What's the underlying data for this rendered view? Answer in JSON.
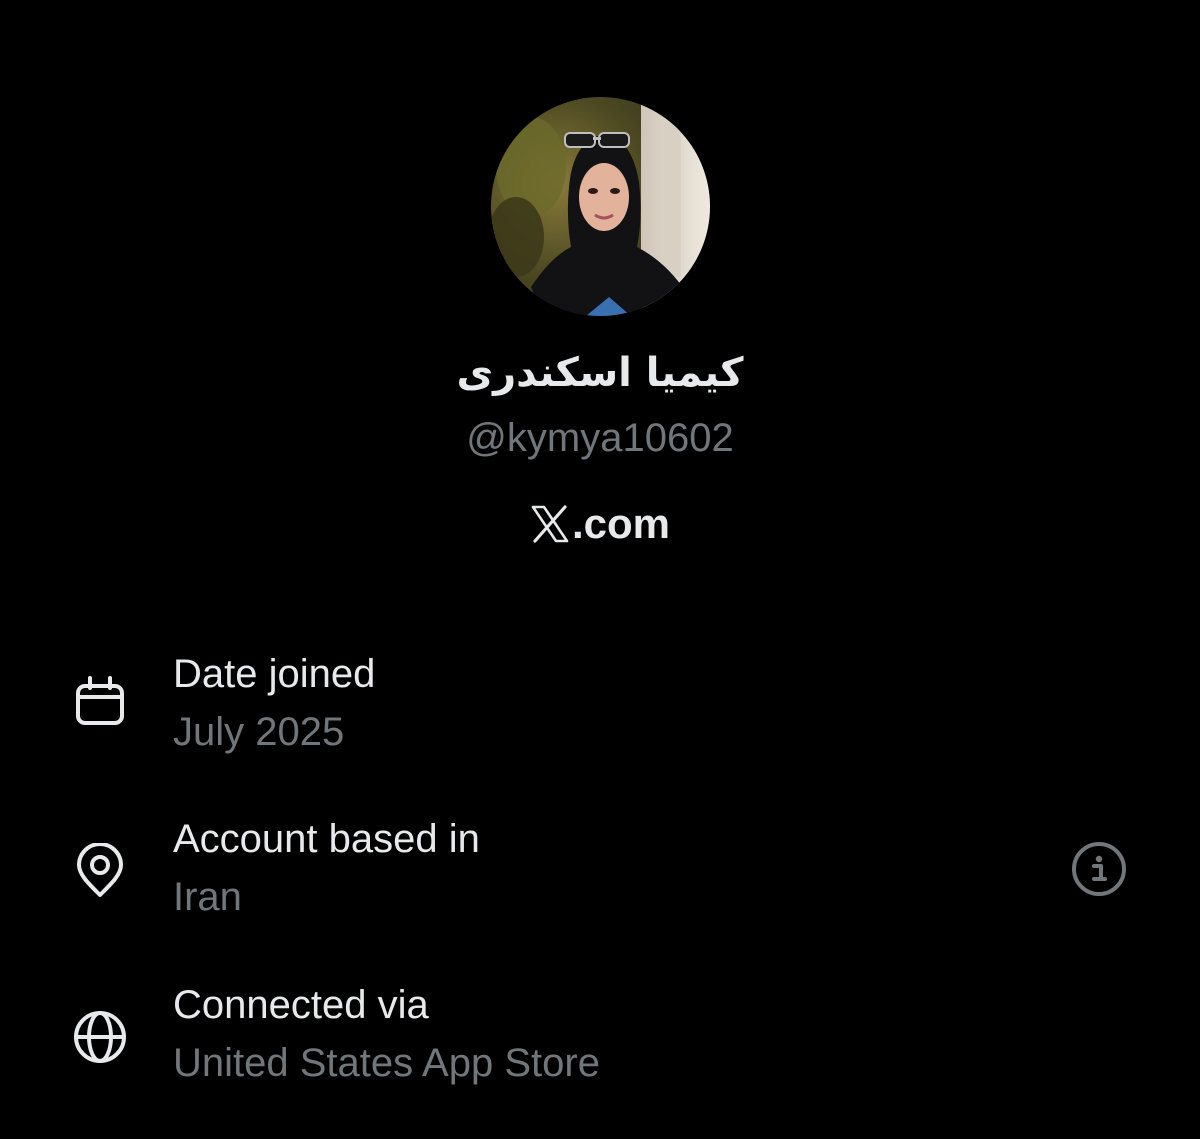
{
  "profile": {
    "display_name": "کیمیا اسکندری",
    "handle": "@kymya10602",
    "platform_domain": ".com",
    "platform_logo_icon": "x-logo-icon"
  },
  "about_rows": [
    {
      "title": "Date joined",
      "value": "July 2025",
      "icon": "calendar-icon"
    },
    {
      "title": "Account based in",
      "value": "Iran",
      "icon": "location-pin-icon",
      "action_icon": "info-icon"
    },
    {
      "title": "Connected via",
      "value": "United States App Store",
      "icon": "globe-icon"
    }
  ],
  "colors": {
    "background": "#000000",
    "primary_text": "#e7e9ea",
    "secondary_text": "#71767b"
  }
}
